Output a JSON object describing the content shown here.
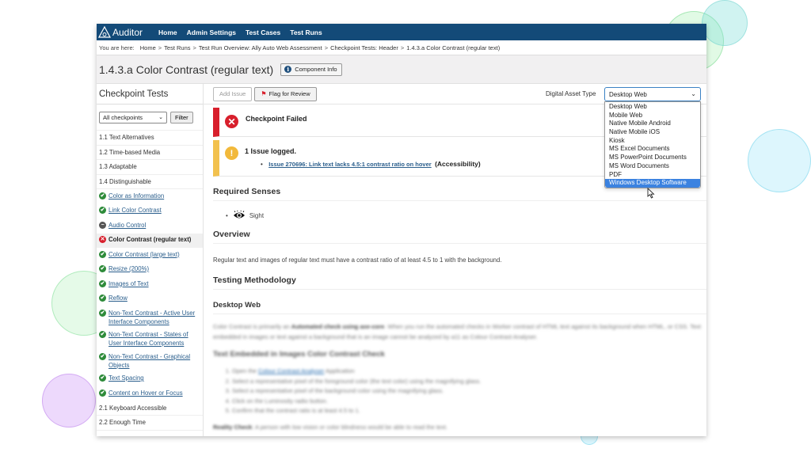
{
  "app": {
    "brand": "Auditor",
    "nav": [
      "Home",
      "Admin Settings",
      "Test Cases",
      "Test Runs"
    ]
  },
  "breadcrumb": {
    "label": "You are here:",
    "items": [
      "Home",
      "Test Runs",
      "Test Run Overview: Ally Auto Web Assessment",
      "Checkpoint Tests: Header",
      "1.4.3.a Color Contrast (regular text)"
    ],
    "separator": ">"
  },
  "page": {
    "title": "1.4.3.a Color Contrast (regular text)",
    "component_info_label": "Component Info"
  },
  "sidebar": {
    "title": "Checkpoint Tests",
    "filter_select": "All checkpoints",
    "filter_button": "Filter",
    "items": [
      {
        "label": "1.1 Text Alternatives",
        "type": "group"
      },
      {
        "label": "1.2 Time-based Media",
        "type": "group"
      },
      {
        "label": "1.3 Adaptable",
        "type": "group"
      },
      {
        "label": "1.4 Distinguishable",
        "type": "group"
      },
      {
        "label": "Color as Information",
        "type": "sub",
        "status": "pass"
      },
      {
        "label": "Link Color Contrast",
        "type": "sub",
        "status": "pass"
      },
      {
        "label": "Audio Control",
        "type": "sub",
        "status": "na"
      },
      {
        "label": "Color Contrast (regular text)",
        "type": "sub",
        "status": "fail",
        "active": true
      },
      {
        "label": "Color Contrast (large text)",
        "type": "sub",
        "status": "pass"
      },
      {
        "label": "Resize (200%)",
        "type": "sub",
        "status": "pass"
      },
      {
        "label": "Images of Text",
        "type": "sub",
        "status": "pass"
      },
      {
        "label": "Reflow",
        "type": "sub",
        "status": "pass"
      },
      {
        "label": "Non-Text Contrast - Active User Interface Components",
        "type": "sub",
        "status": "pass"
      },
      {
        "label": "Non-Text Contrast - States of User Interface Components",
        "type": "sub",
        "status": "pass"
      },
      {
        "label": "Non-Text Contrast - Graphical Objects",
        "type": "sub",
        "status": "pass"
      },
      {
        "label": "Text Spacing",
        "type": "sub",
        "status": "pass"
      },
      {
        "label": "Content on Hover or Focus",
        "type": "sub",
        "status": "pass"
      },
      {
        "label": "2.1 Keyboard Accessible",
        "type": "group"
      },
      {
        "label": "2.2 Enough Time",
        "type": "group"
      }
    ]
  },
  "toolbar": {
    "add_issue": "Add Issue",
    "flag_review": "Flag for Review",
    "asset_type_label": "Digital Asset Type",
    "asset_type_value": "Desktop Web",
    "asset_type_options": [
      "Desktop Web",
      "Mobile Web",
      "Native Mobile Android",
      "Native Mobile iOS",
      "Kiosk",
      "MS Excel Documents",
      "MS PowerPoint Documents",
      "MS Word Documents",
      "PDF",
      "Windows Desktop Software"
    ],
    "highlighted_option": "Windows Desktop Software"
  },
  "status": {
    "result": "Checkpoint Failed",
    "issues_logged": "1 Issue logged.",
    "issue_link": "Issue 270696: Link text lacks 4.5:1 contrast ratio on hover",
    "issue_category": "(Accessibility)"
  },
  "content": {
    "required_senses_heading": "Required Senses",
    "sense": "Sight",
    "overview_heading": "Overview",
    "overview_text": "Regular text and images of regular text must have a contrast ratio of at least 4.5 to 1 with the background.",
    "methodology_heading": "Testing Methodology",
    "platform_heading": "Desktop Web",
    "blurred": {
      "intro_pre": "Color Contrast is primarily an ",
      "intro_bold": "Automated check using axe-core",
      "intro_post": ". When you run the automated checks in Worker contrast of HTML text against its background when HTML, or CSS. Text embedded in images or text against a background that is an image cannot be analyzed by a11 as Colour Contrast Analyser.",
      "subheading": "Text Embedded in Images Color Contrast Check",
      "steps_prefix": "Open the ",
      "steps_link": "Colour Contrast Analyser",
      "steps_suffix": " Application",
      "steps": [
        "Select a representative pixel of the foreground color (the text color) using the magnifying glass.",
        "Select a representative pixel of the background color using the magnifying glass.",
        "Click on the Luminosity radio button.",
        "Confirm that the contrast ratio is at least 4.5 to 1."
      ],
      "reality_bold": "Reality Check",
      "reality_text": ": A person with low vision or color blindness would be able to read the text."
    }
  }
}
